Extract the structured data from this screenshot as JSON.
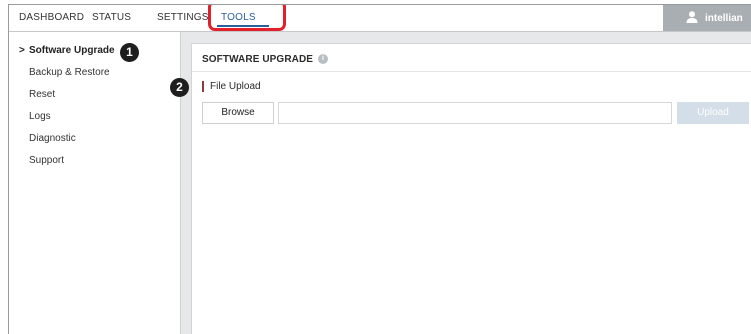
{
  "nav": {
    "dashboard": "DASHBOARD",
    "status": "STATUS",
    "settings": "SETTINGS",
    "tools": "TOOLS"
  },
  "user": {
    "name": "intellian",
    "icon": "user-icon"
  },
  "sidebar": {
    "items": [
      {
        "label": "Software Upgrade",
        "active": true
      },
      {
        "label": "Backup & Restore"
      },
      {
        "label": "Reset"
      },
      {
        "label": "Logs"
      },
      {
        "label": "Diagnostic"
      },
      {
        "label": "Support"
      }
    ],
    "active_marker": ">"
  },
  "panel": {
    "title": "SOFTWARE UPGRADE",
    "info_icon": "i",
    "section_title": "File Upload",
    "browse_label": "Browse",
    "file_value": "",
    "upload_label": "Upload"
  },
  "callouts": {
    "one": "1",
    "two": "2"
  },
  "colors": {
    "highlight": "#e3202a",
    "accent": "#2a5f9e",
    "user_bg": "#a9aeb3",
    "upload_disabled": "#d3dee8",
    "main_bg": "#e6e8ea"
  }
}
